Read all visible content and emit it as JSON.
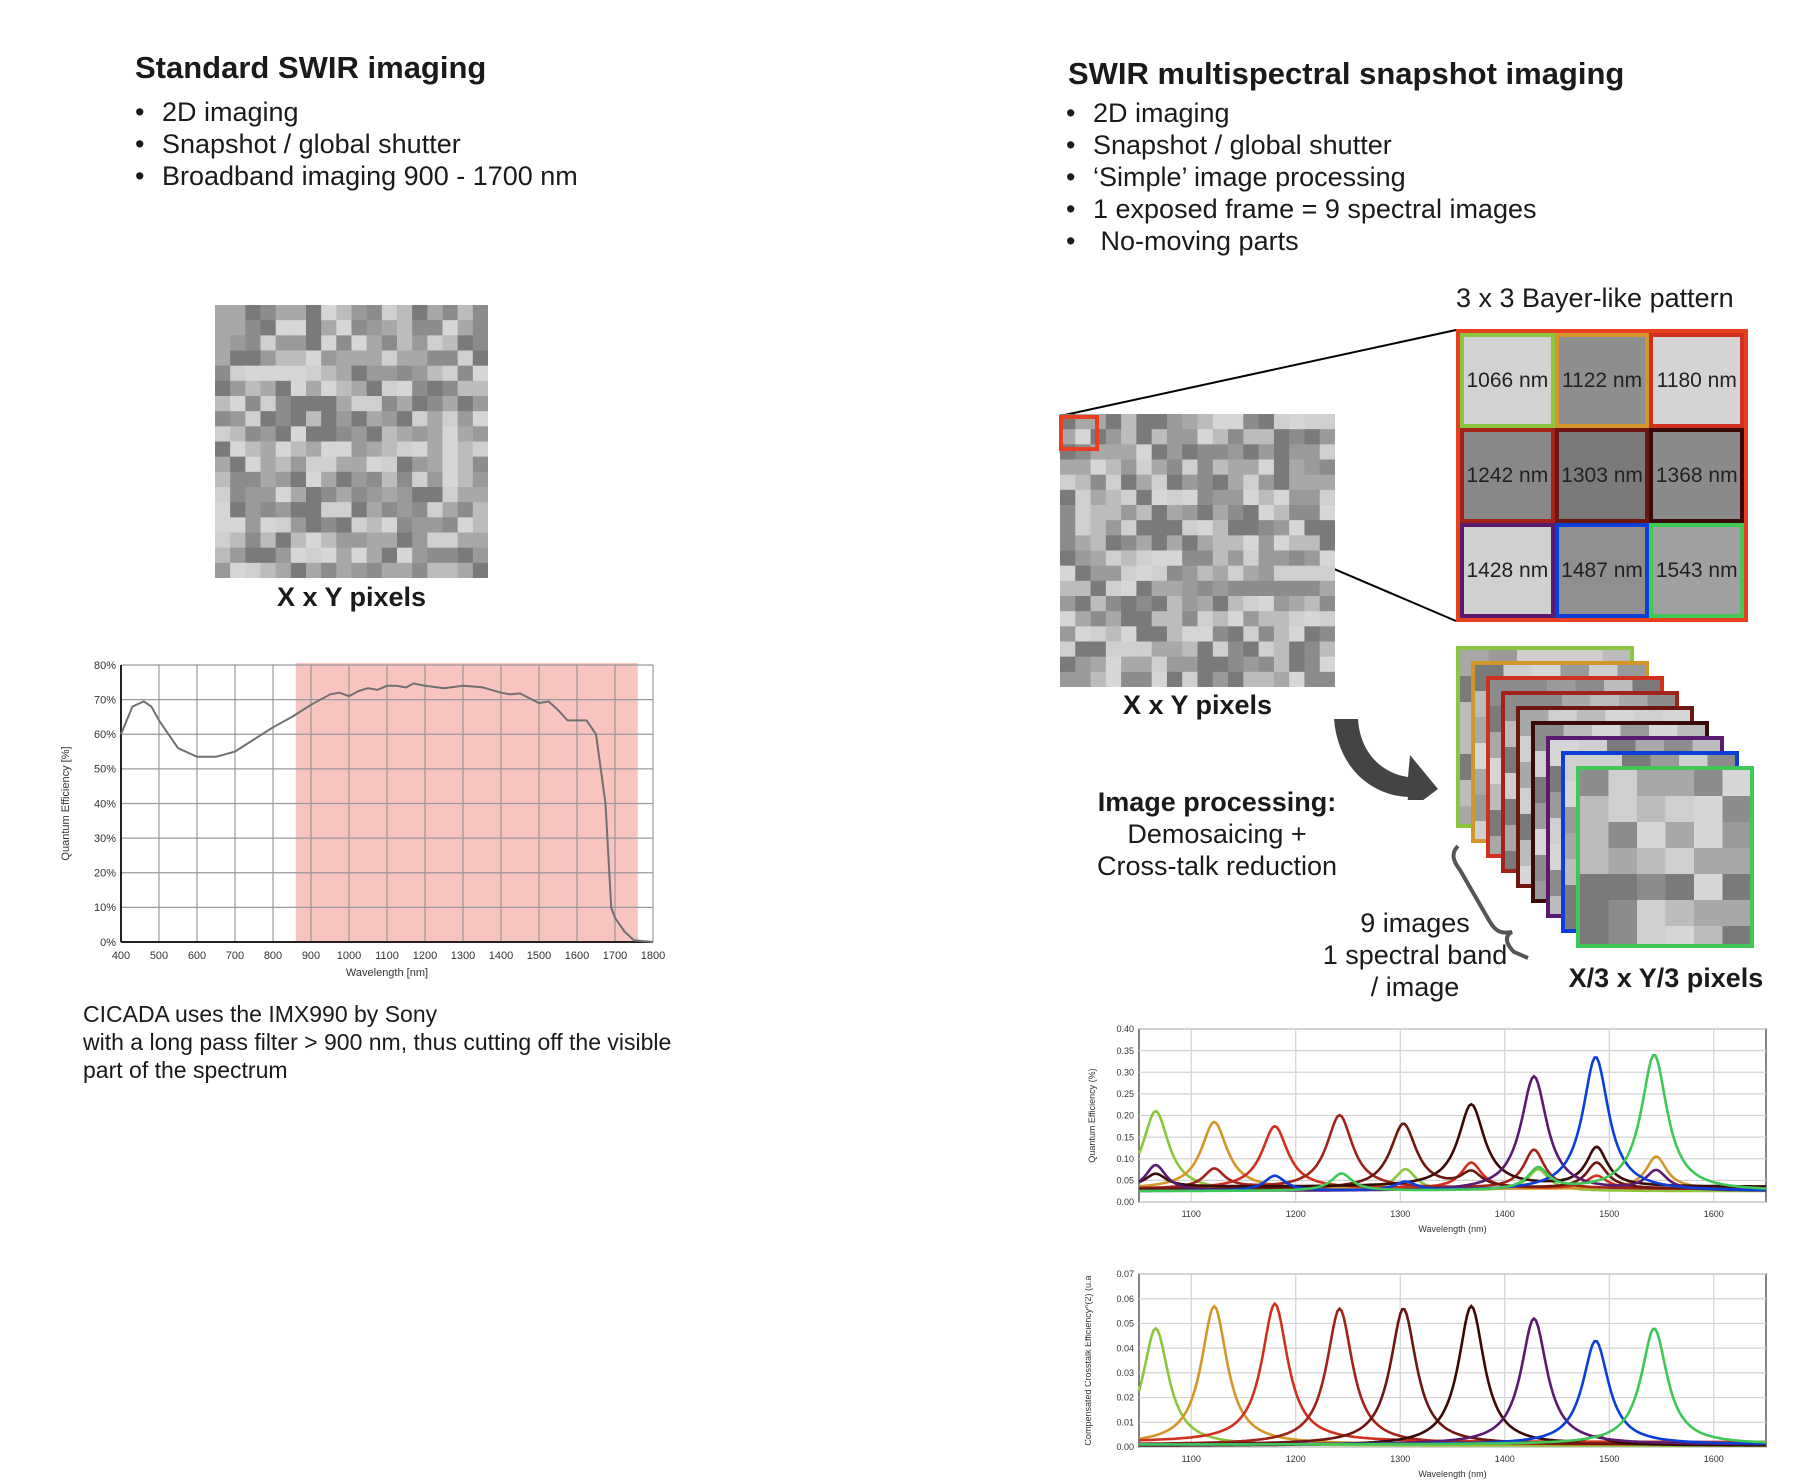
{
  "left": {
    "title": "Standard SWIR imaging",
    "bullets": [
      "2D imaging",
      "Snapshot / global shutter",
      "Broadband imaging 900 - 1700 nm"
    ],
    "mosaic_label": "X x Y pixels",
    "caption": [
      "CICADA uses the IMX990 by Sony",
      "with a long pass filter > 900 nm, thus cutting off the visible",
      "part of the spectrum"
    ]
  },
  "right": {
    "title": "SWIR multispectral snapshot imaging",
    "bullets": [
      "2D imaging",
      "Snapshot / global shutter",
      "‘Simple’ image processing",
      "1 exposed frame = 9 spectral images",
      " No-moving parts"
    ],
    "bayer_title": "3 x 3 Bayer-like pattern",
    "bayer_cells": [
      {
        "label": "1066 nm",
        "color": "#8cc63f",
        "gray": "#d2d2d2"
      },
      {
        "label": "1122 nm",
        "color": "#d4962a",
        "gray": "#8e8e8e"
      },
      {
        "label": "1180 nm",
        "color": "#d0301e",
        "gray": "#d4d4d4"
      },
      {
        "label": "1242 nm",
        "color": "#a2231a",
        "gray": "#888888"
      },
      {
        "label": "1303 nm",
        "color": "#6e1610",
        "gray": "#7a7a7a"
      },
      {
        "label": "1368 nm",
        "color": "#3a0a08",
        "gray": "#8a8a8a"
      },
      {
        "label": "1428 nm",
        "color": "#5a1a70",
        "gray": "#d0d0d0"
      },
      {
        "label": "1487 nm",
        "color": "#0b3fd6",
        "gray": "#8f8f8f"
      },
      {
        "label": "1543 nm",
        "color": "#3fc857",
        "gray": "#a0a0a0"
      }
    ],
    "bayer_frame_color": "#e8401e",
    "mosaic_label": "X x Y pixels",
    "processing": {
      "title": "Image processing:",
      "lines": [
        "Demosaicing +",
        "Cross-talk reduction"
      ]
    },
    "stack_caption": [
      "9 images",
      "1 spectral band",
      "/ image"
    ],
    "stack_label": "X/3 x Y/3 pixels"
  },
  "chart_data": [
    {
      "type": "line",
      "xlabel": "Wavelength [nm]",
      "ylabel": "Quantum Efficiency [%]",
      "xlim": [
        400,
        1800
      ],
      "ylim": [
        0,
        80
      ],
      "xticks": [
        "400",
        "500",
        "600",
        "700",
        "800",
        "900",
        "1000",
        "1100",
        "1200",
        "1300",
        "1400",
        "1500",
        "1600",
        "1700",
        "1800"
      ],
      "yticks": [
        "0%",
        "10%",
        "20%",
        "30%",
        "40%",
        "50%",
        "60%",
        "70%",
        "80%"
      ],
      "grid": true,
      "highlight_band": {
        "from": 860,
        "to": 1760,
        "color": "#f7c4c0"
      },
      "line_color": "#707070",
      "x": [
        400,
        430,
        460,
        480,
        500,
        550,
        600,
        650,
        700,
        750,
        800,
        850,
        900,
        950,
        975,
        1000,
        1025,
        1050,
        1075,
        1100,
        1125,
        1150,
        1170,
        1200,
        1250,
        1300,
        1350,
        1400,
        1425,
        1450,
        1500,
        1525,
        1550,
        1575,
        1600,
        1625,
        1650,
        1675,
        1690,
        1700,
        1725,
        1750,
        1800
      ],
      "y": [
        60,
        68,
        69.5,
        68,
        64,
        56,
        53.5,
        53.5,
        55,
        58.5,
        62,
        65,
        68.5,
        71.5,
        72,
        71,
        72.5,
        73.3,
        72.8,
        74,
        74,
        73.5,
        74.7,
        74,
        73.3,
        74,
        73.6,
        72,
        71.5,
        71.8,
        69,
        69.5,
        67,
        64,
        64,
        64,
        60,
        40,
        10,
        7,
        3,
        0.5,
        0
      ]
    },
    {
      "type": "line",
      "xlabel": "Wavelength (nm)",
      "ylabel": "Quantum Efficiency (%)",
      "xlim": [
        1050,
        1650
      ],
      "ylim": [
        0,
        0.4
      ],
      "xticks": [
        "1100",
        "1200",
        "1300",
        "1400",
        "1500",
        "1600"
      ],
      "yticks": [
        "0.00",
        "0.05",
        "0.10",
        "0.15",
        "0.20",
        "0.25",
        "0.30",
        "0.35",
        "0.40"
      ],
      "grid": true,
      "series": [
        {
          "color": "#8cc63f",
          "peak_nm": 1066,
          "peak": 0.21,
          "baseline": 0.025,
          "secondary": [
            [
              1305,
              0.05
            ],
            [
              1432,
              0.05
            ]
          ]
        },
        {
          "color": "#d4962a",
          "peak_nm": 1122,
          "peak": 0.185,
          "baseline": 0.03,
          "secondary": [
            [
              1545,
              0.075
            ]
          ]
        },
        {
          "color": "#d0301e",
          "peak_nm": 1180,
          "peak": 0.175,
          "baseline": 0.03,
          "secondary": [
            [
              1368,
              0.06
            ],
            [
              1488,
              0.03
            ]
          ]
        },
        {
          "color": "#a2231a",
          "peak_nm": 1242,
          "peak": 0.2,
          "baseline": 0.03,
          "secondary": [
            [
              1122,
              0.045
            ],
            [
              1428,
              0.09
            ]
          ]
        },
        {
          "color": "#6e1610",
          "peak_nm": 1303,
          "peak": 0.18,
          "baseline": 0.03,
          "secondary": [
            [
              1368,
              0.035
            ],
            [
              1488,
              0.06
            ]
          ]
        },
        {
          "color": "#3a0a08",
          "peak_nm": 1368,
          "peak": 0.225,
          "baseline": 0.035,
          "secondary": [
            [
              1066,
              0.03
            ],
            [
              1488,
              0.09
            ]
          ]
        },
        {
          "color": "#5a1a70",
          "peak_nm": 1428,
          "peak": 0.29,
          "baseline": 0.025,
          "secondary": [
            [
              1066,
              0.06
            ],
            [
              1545,
              0.045
            ]
          ]
        },
        {
          "color": "#0b3fd6",
          "peak_nm": 1487,
          "peak": 0.335,
          "baseline": 0.025,
          "secondary": [
            [
              1180,
              0.035
            ],
            [
              1305,
              0.02
            ]
          ]
        },
        {
          "color": "#3fc857",
          "peak_nm": 1543,
          "peak": 0.34,
          "baseline": 0.025,
          "secondary": [
            [
              1244,
              0.04
            ],
            [
              1432,
              0.05
            ]
          ]
        }
      ]
    },
    {
      "type": "line",
      "xlabel": "Wavelength (nm)",
      "ylabel": "Compensated Crosstalk Efficiency^(2) (u.a",
      "xlim": [
        1050,
        1650
      ],
      "ylim": [
        0,
        0.07
      ],
      "xticks": [
        "1100",
        "1200",
        "1300",
        "1400",
        "1500",
        "1600"
      ],
      "yticks": [
        "0.00",
        "0.01",
        "0.02",
        "0.03",
        "0.04",
        "0.05",
        "0.06",
        "0.07"
      ],
      "grid": true,
      "series": [
        {
          "color": "#8cc63f",
          "peak_nm": 1066,
          "peak": 0.048,
          "baseline": 0.0005,
          "secondary": []
        },
        {
          "color": "#d4962a",
          "peak_nm": 1122,
          "peak": 0.057,
          "baseline": 0.001,
          "secondary": []
        },
        {
          "color": "#d0301e",
          "peak_nm": 1180,
          "peak": 0.058,
          "baseline": 0.002,
          "secondary": []
        },
        {
          "color": "#a2231a",
          "peak_nm": 1242,
          "peak": 0.056,
          "baseline": 0.001,
          "secondary": []
        },
        {
          "color": "#6e1610",
          "peak_nm": 1303,
          "peak": 0.056,
          "baseline": 0.001,
          "secondary": []
        },
        {
          "color": "#3a0a08",
          "peak_nm": 1368,
          "peak": 0.057,
          "baseline": 0.0005,
          "secondary": [
            [
              1488,
              0.003
            ]
          ]
        },
        {
          "color": "#5a1a70",
          "peak_nm": 1428,
          "peak": 0.052,
          "baseline": 0.001,
          "secondary": []
        },
        {
          "color": "#0b3fd6",
          "peak_nm": 1487,
          "peak": 0.043,
          "baseline": 0.001,
          "secondary": []
        },
        {
          "color": "#3fc857",
          "peak_nm": 1543,
          "peak": 0.048,
          "baseline": 0.001,
          "secondary": []
        }
      ]
    }
  ]
}
